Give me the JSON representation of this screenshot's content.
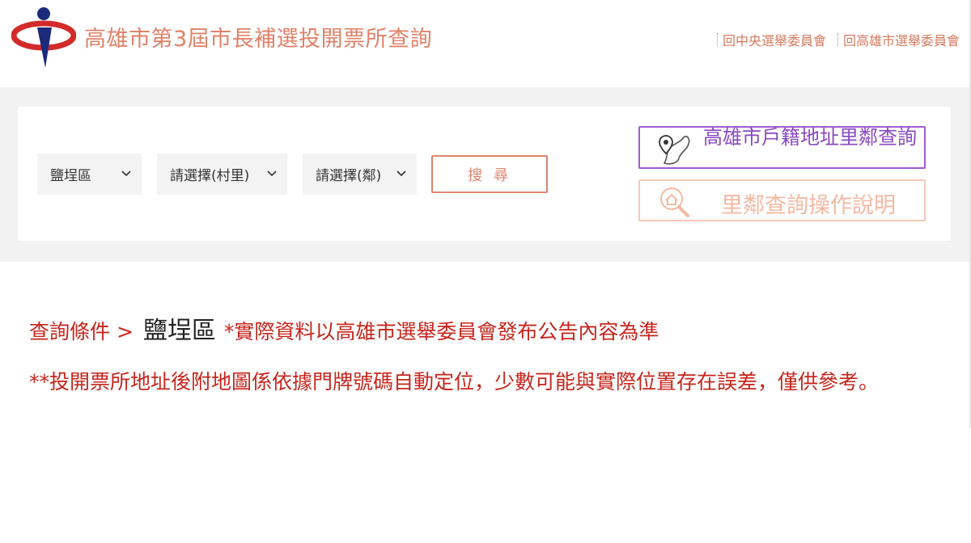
{
  "header": {
    "title": "高雄市第3屆市長補選投開票所查詢",
    "links": [
      {
        "label": "回中央選舉委員會"
      },
      {
        "label": "回高雄市選舉委員會"
      }
    ]
  },
  "search": {
    "district": "鹽埕區",
    "village": "請選擇(村里)",
    "neighborhood": "請選擇(鄰)",
    "button_label": "搜 尋"
  },
  "side_buttons": {
    "household_lookup": "高雄市戶籍地址里鄰查詢",
    "help": "里鄰查詢操作說明"
  },
  "result": {
    "prefix": "查詢條件 >",
    "district": "鹽埕區",
    "note": "*實際資料以高雄市選舉委員會發布公告內容為準",
    "disclaimer": "**投開票所地址後附地圖係依據門牌號碼自動定位，少數可能與實際位置存在誤差，僅供參考。"
  },
  "colors": {
    "brand": "#e0826a",
    "accent_purple": "#a15ad2",
    "result_red": "#c8261e",
    "band": "#f2f2f2"
  }
}
